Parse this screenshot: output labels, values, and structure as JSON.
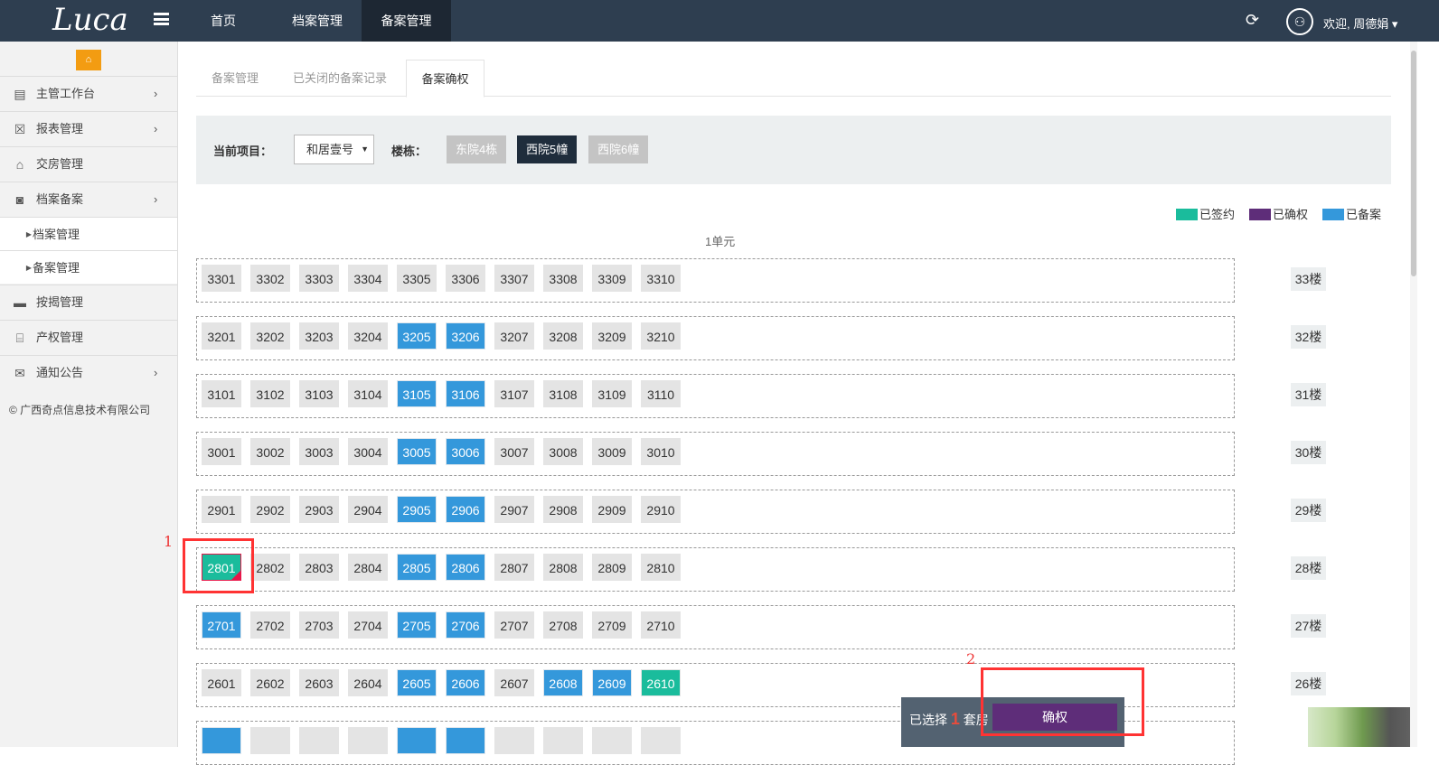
{
  "header": {
    "logo": "Luca",
    "nav": [
      "首页",
      "档案管理",
      "备案管理"
    ],
    "active_nav": 2,
    "welcome": "欢迎, 周德娟 ▾"
  },
  "sidebar": {
    "items": [
      {
        "label": "主管工作台",
        "icon": "file-icon",
        "arrow": true
      },
      {
        "label": "报表管理",
        "icon": "excel-icon",
        "arrow": true
      },
      {
        "label": "交房管理",
        "icon": "home-icon",
        "arrow": false
      },
      {
        "label": "档案备案",
        "icon": "contact-icon",
        "arrow": true
      },
      {
        "label": "档案管理",
        "sub": true
      },
      {
        "label": "备案管理",
        "sub": true
      },
      {
        "label": "按揭管理",
        "icon": "card-icon",
        "arrow": false
      },
      {
        "label": "产权管理",
        "icon": "bank-icon",
        "arrow": false
      },
      {
        "label": "通知公告",
        "icon": "comments-icon",
        "arrow": true
      }
    ],
    "copyright": "© 广西奇点信息技术有限公司"
  },
  "tabs": [
    "备案管理",
    "已关闭的备案记录",
    "备案确权"
  ],
  "filter": {
    "project_label": "当前项目：",
    "project_value": "和居壹号",
    "building_label": "楼栋：",
    "buildings": [
      "东院4栋",
      "西院5幢",
      "西院6幢"
    ],
    "active_building": 1
  },
  "legend": [
    {
      "label": "已签约",
      "color": "#1abc9c"
    },
    {
      "label": "已确权",
      "color": "#5e2d79"
    },
    {
      "label": "已备案",
      "color": "#3498db"
    }
  ],
  "unit": "1单元",
  "rows": [
    {
      "floor": "33楼",
      "cells": [
        [
          "3301",
          ""
        ],
        [
          "3302",
          ""
        ],
        [
          "3303",
          ""
        ],
        [
          "3304",
          ""
        ],
        [
          "3305",
          ""
        ],
        [
          "3306",
          ""
        ],
        [
          "3307",
          ""
        ],
        [
          "3308",
          ""
        ],
        [
          "3309",
          ""
        ],
        [
          "3310",
          ""
        ]
      ]
    },
    {
      "floor": "32楼",
      "cells": [
        [
          "3201",
          ""
        ],
        [
          "3202",
          ""
        ],
        [
          "3203",
          ""
        ],
        [
          "3204",
          ""
        ],
        [
          "3205",
          "filed"
        ],
        [
          "3206",
          "filed"
        ],
        [
          "3207",
          ""
        ],
        [
          "3208",
          ""
        ],
        [
          "3209",
          ""
        ],
        [
          "3210",
          ""
        ]
      ]
    },
    {
      "floor": "31楼",
      "cells": [
        [
          "3101",
          ""
        ],
        [
          "3102",
          ""
        ],
        [
          "3103",
          ""
        ],
        [
          "3104",
          ""
        ],
        [
          "3105",
          "filed"
        ],
        [
          "3106",
          "filed"
        ],
        [
          "3107",
          ""
        ],
        [
          "3108",
          ""
        ],
        [
          "3109",
          ""
        ],
        [
          "3110",
          ""
        ]
      ]
    },
    {
      "floor": "30楼",
      "cells": [
        [
          "3001",
          ""
        ],
        [
          "3002",
          ""
        ],
        [
          "3003",
          ""
        ],
        [
          "3004",
          ""
        ],
        [
          "3005",
          "filed"
        ],
        [
          "3006",
          "filed"
        ],
        [
          "3007",
          ""
        ],
        [
          "3008",
          ""
        ],
        [
          "3009",
          ""
        ],
        [
          "3010",
          ""
        ]
      ]
    },
    {
      "floor": "29楼",
      "cells": [
        [
          "2901",
          ""
        ],
        [
          "2902",
          ""
        ],
        [
          "2903",
          ""
        ],
        [
          "2904",
          ""
        ],
        [
          "2905",
          "filed"
        ],
        [
          "2906",
          "filed"
        ],
        [
          "2907",
          ""
        ],
        [
          "2908",
          ""
        ],
        [
          "2909",
          ""
        ],
        [
          "2910",
          ""
        ]
      ]
    },
    {
      "floor": "28楼",
      "cells": [
        [
          "2801",
          "signed sel"
        ],
        [
          "2802",
          ""
        ],
        [
          "2803",
          ""
        ],
        [
          "2804",
          ""
        ],
        [
          "2805",
          "filed"
        ],
        [
          "2806",
          "filed"
        ],
        [
          "2807",
          ""
        ],
        [
          "2808",
          ""
        ],
        [
          "2809",
          ""
        ],
        [
          "2810",
          ""
        ]
      ]
    },
    {
      "floor": "27楼",
      "cells": [
        [
          "2701",
          "filed"
        ],
        [
          "2702",
          ""
        ],
        [
          "2703",
          ""
        ],
        [
          "2704",
          ""
        ],
        [
          "2705",
          "filed"
        ],
        [
          "2706",
          "filed"
        ],
        [
          "2707",
          ""
        ],
        [
          "2708",
          ""
        ],
        [
          "2709",
          ""
        ],
        [
          "2710",
          ""
        ]
      ]
    },
    {
      "floor": "26楼",
      "cells": [
        [
          "2601",
          ""
        ],
        [
          "2602",
          ""
        ],
        [
          "2603",
          ""
        ],
        [
          "2604",
          ""
        ],
        [
          "2605",
          "filed"
        ],
        [
          "2606",
          "filed"
        ],
        [
          "2607",
          ""
        ],
        [
          "2608",
          "filed"
        ],
        [
          "2609",
          "filed"
        ],
        [
          "2610",
          "signed"
        ]
      ]
    },
    {
      "floor": "",
      "cells": [
        [
          "",
          "filed"
        ],
        [
          "",
          ""
        ],
        [
          "",
          ""
        ],
        [
          "",
          ""
        ],
        [
          "",
          "filed"
        ],
        [
          "",
          "filed"
        ],
        [
          "",
          ""
        ],
        [
          "",
          ""
        ],
        [
          "",
          ""
        ],
        [
          "",
          ""
        ]
      ]
    }
  ],
  "annotations": [
    "1",
    "2"
  ],
  "selection": {
    "prefix": "已选择",
    "count": "1",
    "suffix": "套房",
    "confirm": "确权"
  }
}
